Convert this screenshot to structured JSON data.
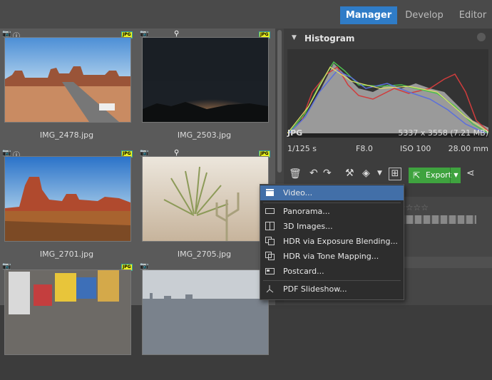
{
  "tabs": {
    "manager": "Manager",
    "develop": "Develop",
    "editor": "Editor"
  },
  "photos": [
    {
      "name": "IMG_2478.jpg",
      "badge": "JPG"
    },
    {
      "name": "IMG_2503.jpg",
      "badge": "JPG"
    },
    {
      "name": "IMG_2701.jpg",
      "badge": "JPG"
    },
    {
      "name": "IMG_2705.jpg",
      "badge": "JPG"
    },
    {
      "name": "",
      "badge": "JPG"
    },
    {
      "name": "",
      "badge": ""
    }
  ],
  "histogram": {
    "title": "Histogram"
  },
  "info": {
    "format": "JPG",
    "dimensions": "5337 x 3558 (7.21 MB)",
    "shutter": "1/125 s",
    "aperture": "F8.0",
    "iso": "ISO 100",
    "focal": "28.00 mm"
  },
  "toolbar": {
    "export_label": "Export"
  },
  "menu": {
    "items": [
      "Video...",
      "Panorama...",
      "3D Images...",
      "HDR via Exposure Blending...",
      "HDR via Tone Mapping...",
      "Postcard...",
      "PDF Slideshow..."
    ]
  },
  "colors": {
    "accent": "#2f7cc7",
    "export": "#3fa33f",
    "menu_highlight": "#426fa8",
    "jpg_badge": "#e9f020"
  }
}
